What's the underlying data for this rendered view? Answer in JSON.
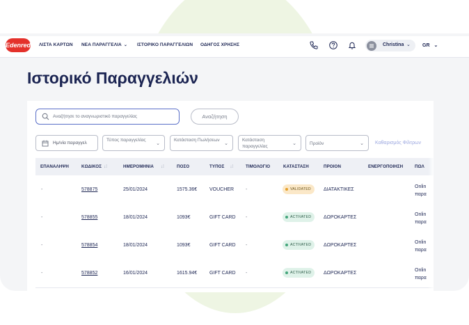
{
  "brand": {
    "logo_text": "Edenred",
    "accent": "#e4312b",
    "navy": "#1b2452",
    "link": "#9aa6df"
  },
  "nav": {
    "items": [
      "ΛΙΣΤΑ ΚΑΡΤΩΝ",
      "ΝΕΑ ΠΑΡΑΓΓΕΛΙΑ",
      "ΙΣΤΟΡΙΚΟ ΠΑΡΑΓΓΕΛΙΩΝ",
      "ΟΔΗΓΟΣ ΧΡΗΣΗΣ"
    ],
    "icons": [
      "phone-icon",
      "help-icon",
      "bell-icon"
    ],
    "user_name": "Christina",
    "language": "GR"
  },
  "page": {
    "title": "Ιστορικό Παραγγελιών"
  },
  "search": {
    "placeholder": "Αναζήτησε το αναγνωριστικό παραγγελίας",
    "button_label": "Αναζήτηση"
  },
  "filters": {
    "date": "Ημ/νία παραγγελ",
    "type": "Τύπος παραγγελίας",
    "sales_status": "Κατάσταση Πωλήσεων",
    "order_status": "Κατάσταση παραγγελίας",
    "product": "Προϊόν",
    "clear": "Καθαρισμός Φίλτρων"
  },
  "table": {
    "headers": [
      "ΕΠΑΝΑΛΗΨΗ",
      "ΚΩΔΙΚΟΣ",
      "ΗΜΕΡΟΜΗΝΙΑ",
      "ΠΟΣΟ",
      "ΤΥΠΟΣ",
      "ΤΙΜΟΛΟΓΙΟ",
      "ΚΑΤΑΣΤΑΣΗ",
      "ΠΡΟΙΟΝ",
      "ΕΝΕΡΓΟΠΟΙΗΣΗ",
      "ΠΩΛ"
    ],
    "rows": [
      {
        "repeat": "-",
        "code": "578875",
        "date": "25/01/2024",
        "amount": "1575.36€",
        "type": "VOUCHER",
        "invoice": "-",
        "status": "VALIDATED",
        "product": "ΔΙΑΤΑΚΤΙΚΕΣ",
        "activation": "",
        "sales_1": "Onlin",
        "sales_2": "παρα"
      },
      {
        "repeat": "-",
        "code": "578855",
        "date": "18/01/2024",
        "amount": "1093€",
        "type": "GIFT CARD",
        "invoice": "-",
        "status": "ACTIVATED",
        "product": "ΔΩΡΟΚΑΡΤΕΣ",
        "activation": "",
        "sales_1": "Onlin",
        "sales_2": "παρα"
      },
      {
        "repeat": "-",
        "code": "578854",
        "date": "18/01/2024",
        "amount": "1093€",
        "type": "GIFT CARD",
        "invoice": "-",
        "status": "ACTIVATED",
        "product": "ΔΩΡΟΚΑΡΤΕΣ",
        "activation": "",
        "sales_1": "Onlin",
        "sales_2": "παρα"
      },
      {
        "repeat": "-",
        "code": "578852",
        "date": "16/01/2024",
        "amount": "1615.94€",
        "type": "GIFT CARD",
        "invoice": "-",
        "status": "ACTIVATED",
        "product": "ΔΩΡΟΚΑΡΤΕΣ",
        "activation": "",
        "sales_1": "Onlin",
        "sales_2": "παρα"
      }
    ]
  }
}
